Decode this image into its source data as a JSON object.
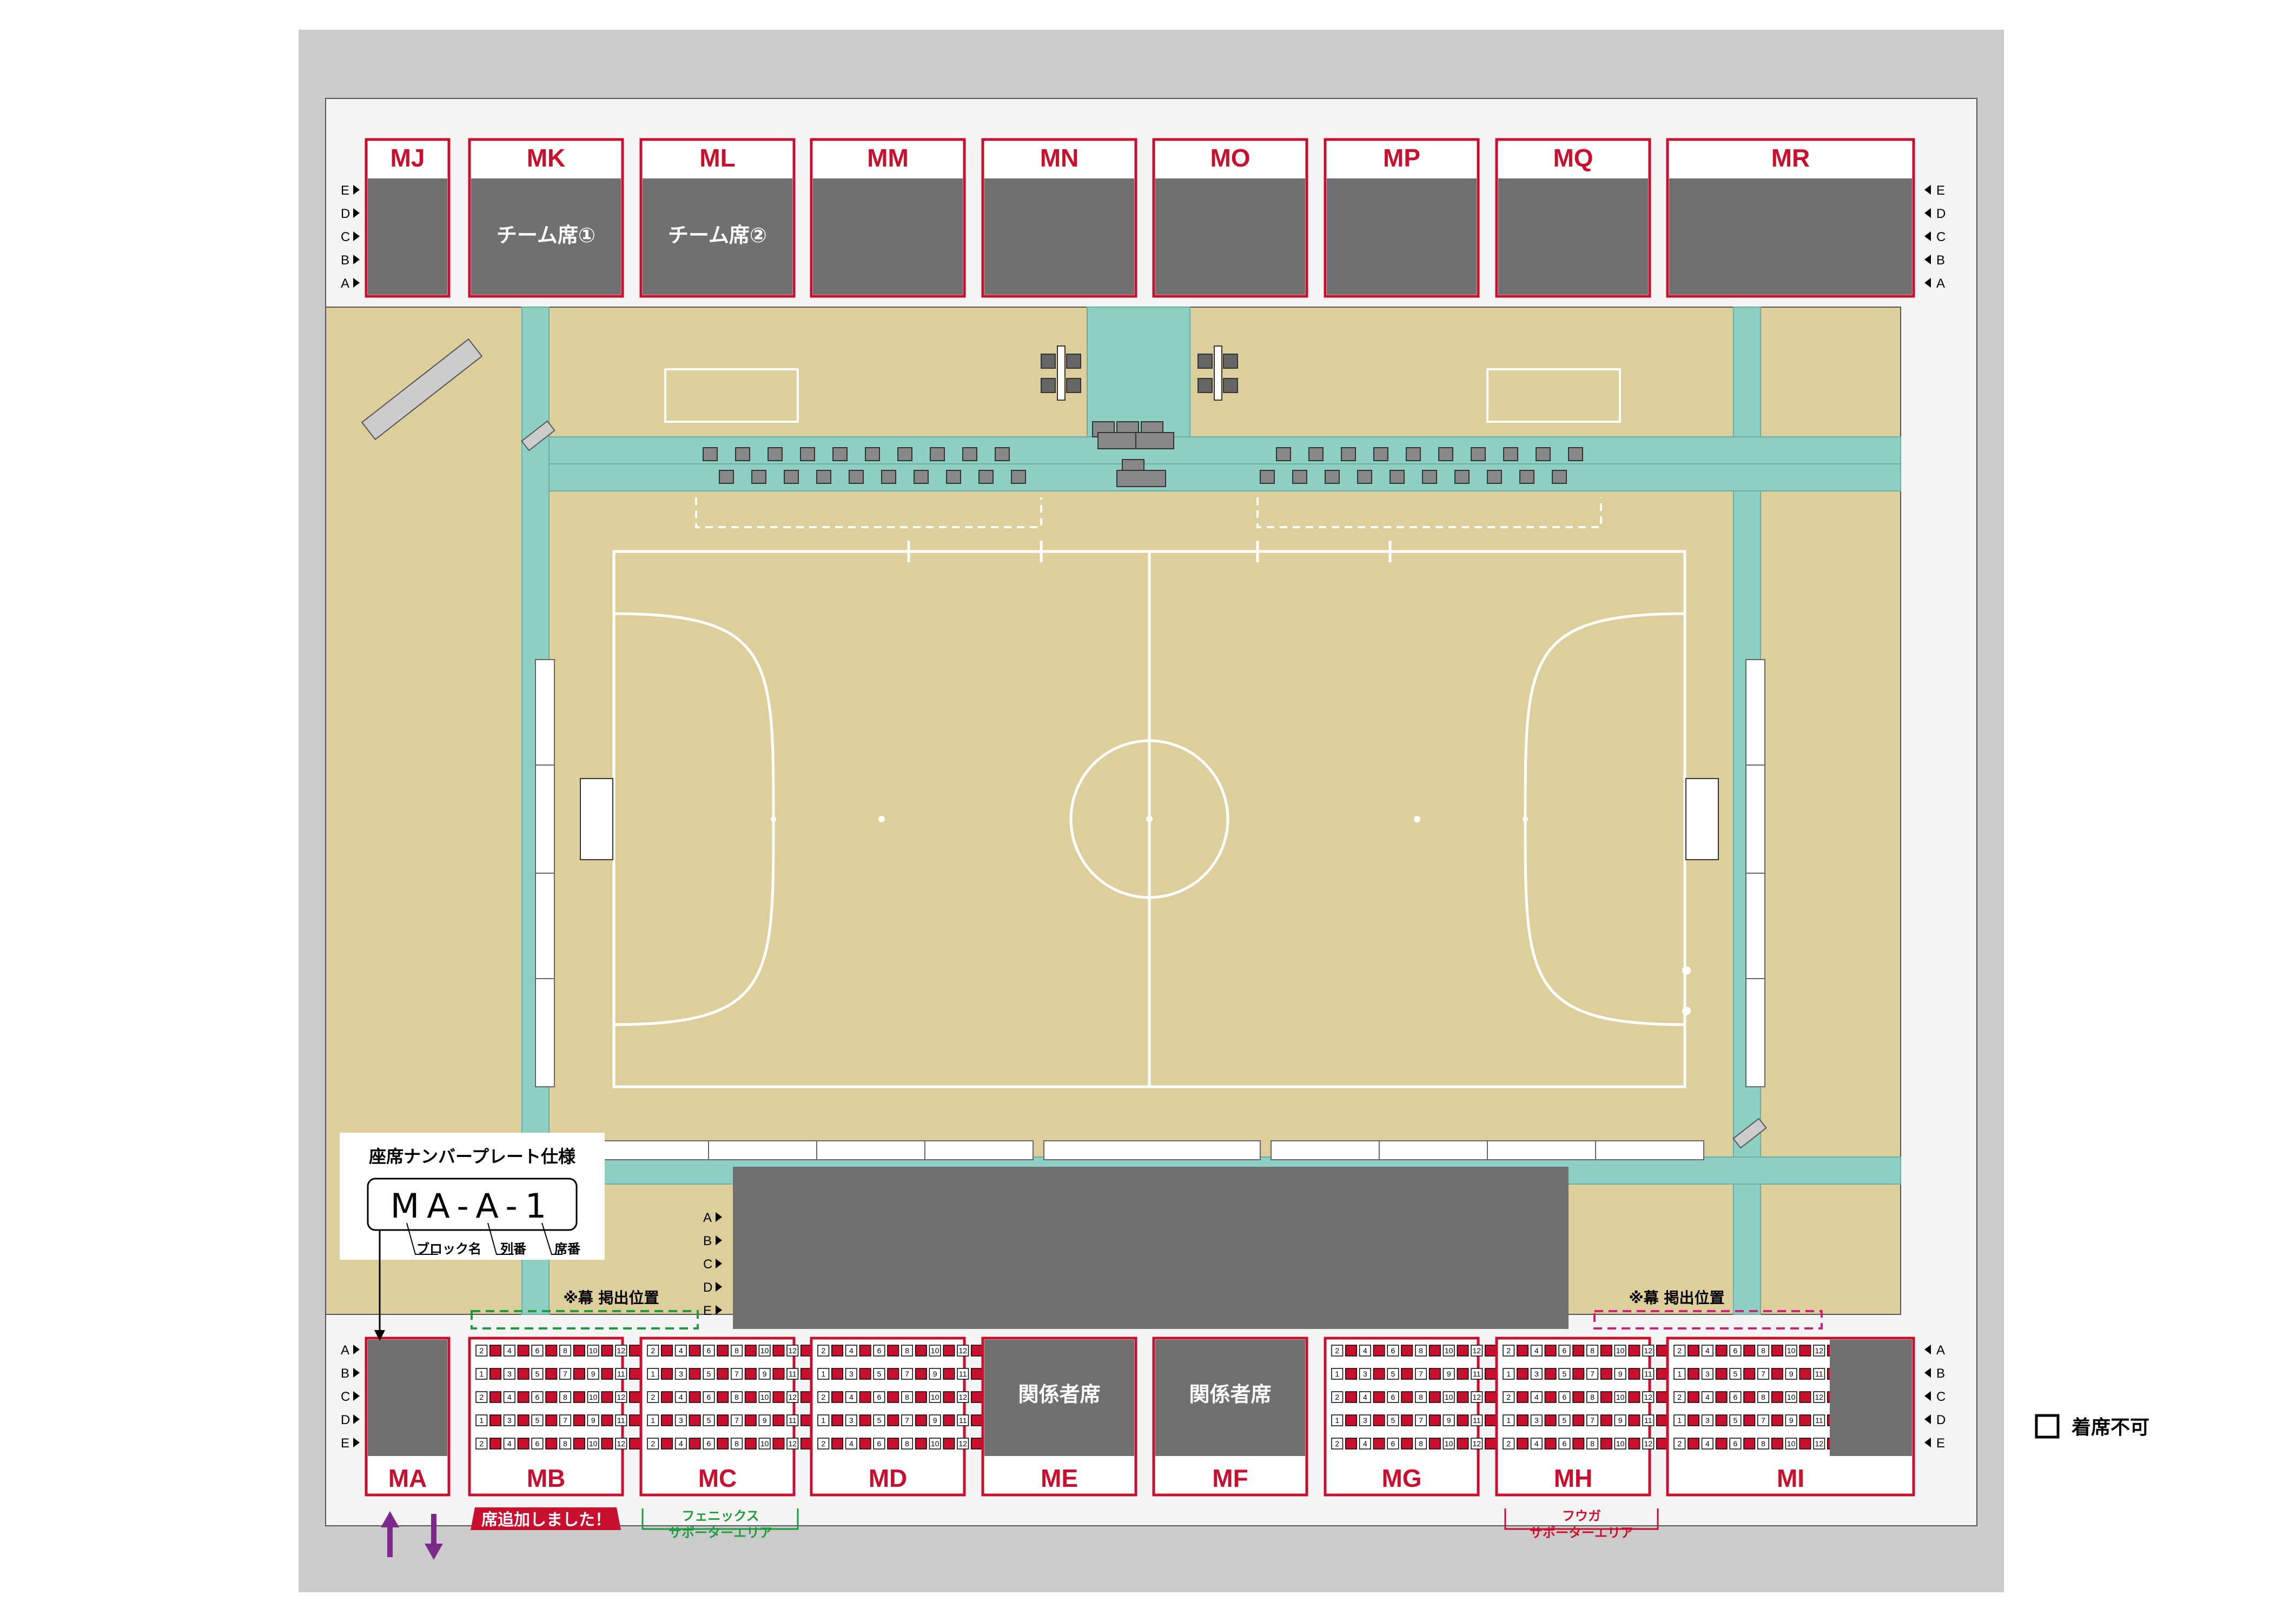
{
  "title": "",
  "upper_blocks": [
    {
      "code": "MJ",
      "label": ""
    },
    {
      "code": "MK",
      "label": "チーム席①"
    },
    {
      "code": "ML",
      "label": "チーム席②"
    },
    {
      "code": "MM",
      "label": ""
    },
    {
      "code": "MN",
      "label": ""
    },
    {
      "code": "MO",
      "label": ""
    },
    {
      "code": "MP",
      "label": ""
    },
    {
      "code": "MQ",
      "label": ""
    },
    {
      "code": "MR",
      "label": ""
    }
  ],
  "lower_blocks": [
    {
      "code": "MA",
      "type": "unavailable",
      "label": ""
    },
    {
      "code": "MB",
      "type": "seats",
      "label": ""
    },
    {
      "code": "MC",
      "type": "seats",
      "label": ""
    },
    {
      "code": "MD",
      "type": "seats",
      "label": ""
    },
    {
      "code": "ME",
      "type": "staff",
      "label": "関係者席"
    },
    {
      "code": "MF",
      "type": "staff",
      "label": "関係者席"
    },
    {
      "code": "MG",
      "type": "seats",
      "label": ""
    },
    {
      "code": "MH",
      "type": "seats",
      "label": ""
    },
    {
      "code": "MI",
      "type": "seats-partial",
      "label": ""
    }
  ],
  "upper_rows": [
    "E",
    "D",
    "C",
    "B",
    "A"
  ],
  "lower_rows": [
    "A",
    "B",
    "C",
    "D",
    "E"
  ],
  "seat_rows": [
    [
      "2",
      "4",
      "6",
      "8",
      "10",
      "12"
    ],
    [
      "1",
      "3",
      "5",
      "7",
      "9",
      "11"
    ],
    [
      "2",
      "4",
      "6",
      "8",
      "10",
      "12"
    ],
    [
      "1",
      "3",
      "5",
      "7",
      "9",
      "11"
    ],
    [
      "2",
      "4",
      "6",
      "8",
      "10",
      "12"
    ]
  ],
  "plate_spec": {
    "title": "座席ナンバープレート仕様",
    "example": "MA-A-1",
    "parts": [
      "ブロック名",
      "列番",
      "席番"
    ]
  },
  "banner_note_left": "※幕 掲出位置",
  "banner_note_right": "※幕 掲出位置",
  "added_seats_note": "席追加しました！",
  "phoenix_area": {
    "line1": "フェニックス",
    "line2": "サポーターエリア"
  },
  "fuga_area": {
    "line1": "フウガ",
    "line2": "サポーターエリア"
  },
  "legend": {
    "label": "着席不可"
  },
  "colors": {
    "accent": "#c8102e",
    "floor": "#dccf9c",
    "corridor": "#8ecfc4",
    "block": "#707070",
    "outer": "#cbcbcb",
    "phoenix": "#1e9b3c",
    "fuga": "#d1207a",
    "arrow": "#7b2a8c"
  }
}
